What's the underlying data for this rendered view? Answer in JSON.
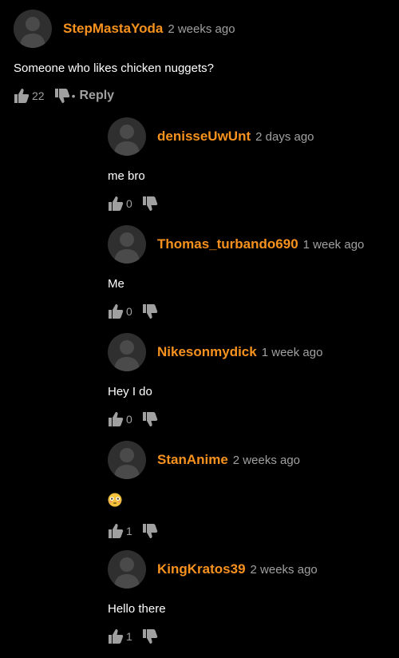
{
  "colors": {
    "background": "#000000",
    "username": "#f7921e",
    "meta": "#a0a0a0",
    "text": "#ffffff",
    "avatar": "#2f2f2f"
  },
  "icons": {
    "avatar": "avatar-placeholder-icon",
    "like": "thumbs-up-icon",
    "dislike": "thumbs-down-icon",
    "emoji": "flushed-face-emoji"
  },
  "main_comment": {
    "username": "StepMastaYoda",
    "time": "2 weeks ago",
    "text": "Someone who likes chicken nuggets?",
    "likes": "22",
    "separator": "•",
    "reply_label": "Reply"
  },
  "replies": [
    {
      "username": "denisseUwUnt",
      "time": "2 days ago",
      "text": "me bro",
      "likes": "0"
    },
    {
      "username": "Thomas_turbando690",
      "time": "1 week ago",
      "text": "Me",
      "likes": "0"
    },
    {
      "username": "Nikesonmydick",
      "time": "1 week ago",
      "text": "Hey I do",
      "likes": "0"
    },
    {
      "username": "StanAnime",
      "time": "2 weeks ago",
      "text": "😳",
      "likes": "1"
    },
    {
      "username": "KingKratos39",
      "time": "2 weeks ago",
      "text": "Hello there",
      "likes": "1"
    }
  ]
}
